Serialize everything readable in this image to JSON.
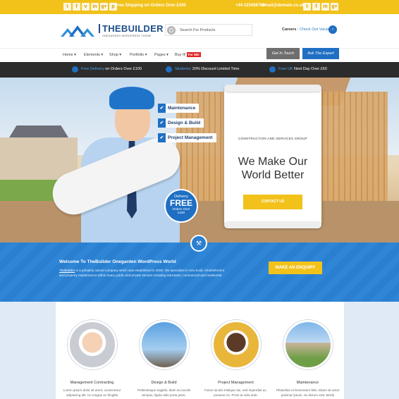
{
  "topbar": {
    "shipping": "Free Shipping on Orders Over £100",
    "phone": "+44 123456789",
    "email": "email@domain.co.uk",
    "social_left": [
      "t",
      "f",
      "v",
      "in",
      "g+",
      "p"
    ],
    "social_right": [
      "t",
      "f",
      "in",
      "g+"
    ]
  },
  "logo": {
    "title": "THEBUILDER",
    "subtitle": "ONEGARDEN WORDPRESS THEME"
  },
  "search": {
    "placeholder": "Search For Products"
  },
  "careers": {
    "label": "Careers",
    "link": "Check Out Vacancies"
  },
  "nav": {
    "items": [
      "Home",
      "Elements",
      "Shop",
      "Portfolio",
      "Pages",
      "Buy It!"
    ],
    "buy_badge": "For $60",
    "get_in_touch": "Get In Touch",
    "ask_expert": "Ask The Expert"
  },
  "infobar": {
    "delivery_hl": "Free Delivery",
    "delivery": "on Orders Over £100",
    "students_hl": "Students",
    "students": "20% Discount Limited Time",
    "next_day_hl": "Free UK",
    "next_day": "Next Day Over £60"
  },
  "hero": {
    "checks": [
      "Maintenance",
      "Design & Build",
      "Project Management"
    ],
    "delivery_badge": {
      "line1": "Delivery",
      "line2": "FREE",
      "line3": "Orders Over",
      "line4": "£100"
    },
    "kicker": "CONSTRUCTION AND SERVICES GROUP",
    "headline_1": "We Make Our",
    "headline_2": "World Better",
    "cta": "CONTACT US"
  },
  "band": {
    "heading": "Welcome To TheBuilder Onegarden WordPress World",
    "brand": "TheBuilder",
    "body": " is a privately owned company which was established in 2000. We specialise in new build, refurbishment and property maintenance within many public and private sectors including education, commercial and residential.",
    "enquiry": "MAKE AN ENQUIRY"
  },
  "services": [
    {
      "title": "Management Contracting",
      "desc": "Lorem ipsum dolor sit amet, consectetur adipiscing elit. Ut congue ex fringilla"
    },
    {
      "title": "Design & Build",
      "desc": "Pellentesque sagittis, diam eu iaculis tempus, ligula odio porta justo,"
    },
    {
      "title": "Project Management",
      "desc": "Fusce iaculis tristique dui, sed imperdiet ac, posuere ex. Proin at odio ante."
    },
    {
      "title": "Maintenance",
      "desc": "Phasellus et fermentum felis. Etiam sit amet pulvinar ipsum, eu dictum erat. Morbi"
    }
  ],
  "colors": {
    "yellow": "#f2c21b",
    "blue": "#1f6fc3",
    "dark": "#2c2c2c"
  }
}
